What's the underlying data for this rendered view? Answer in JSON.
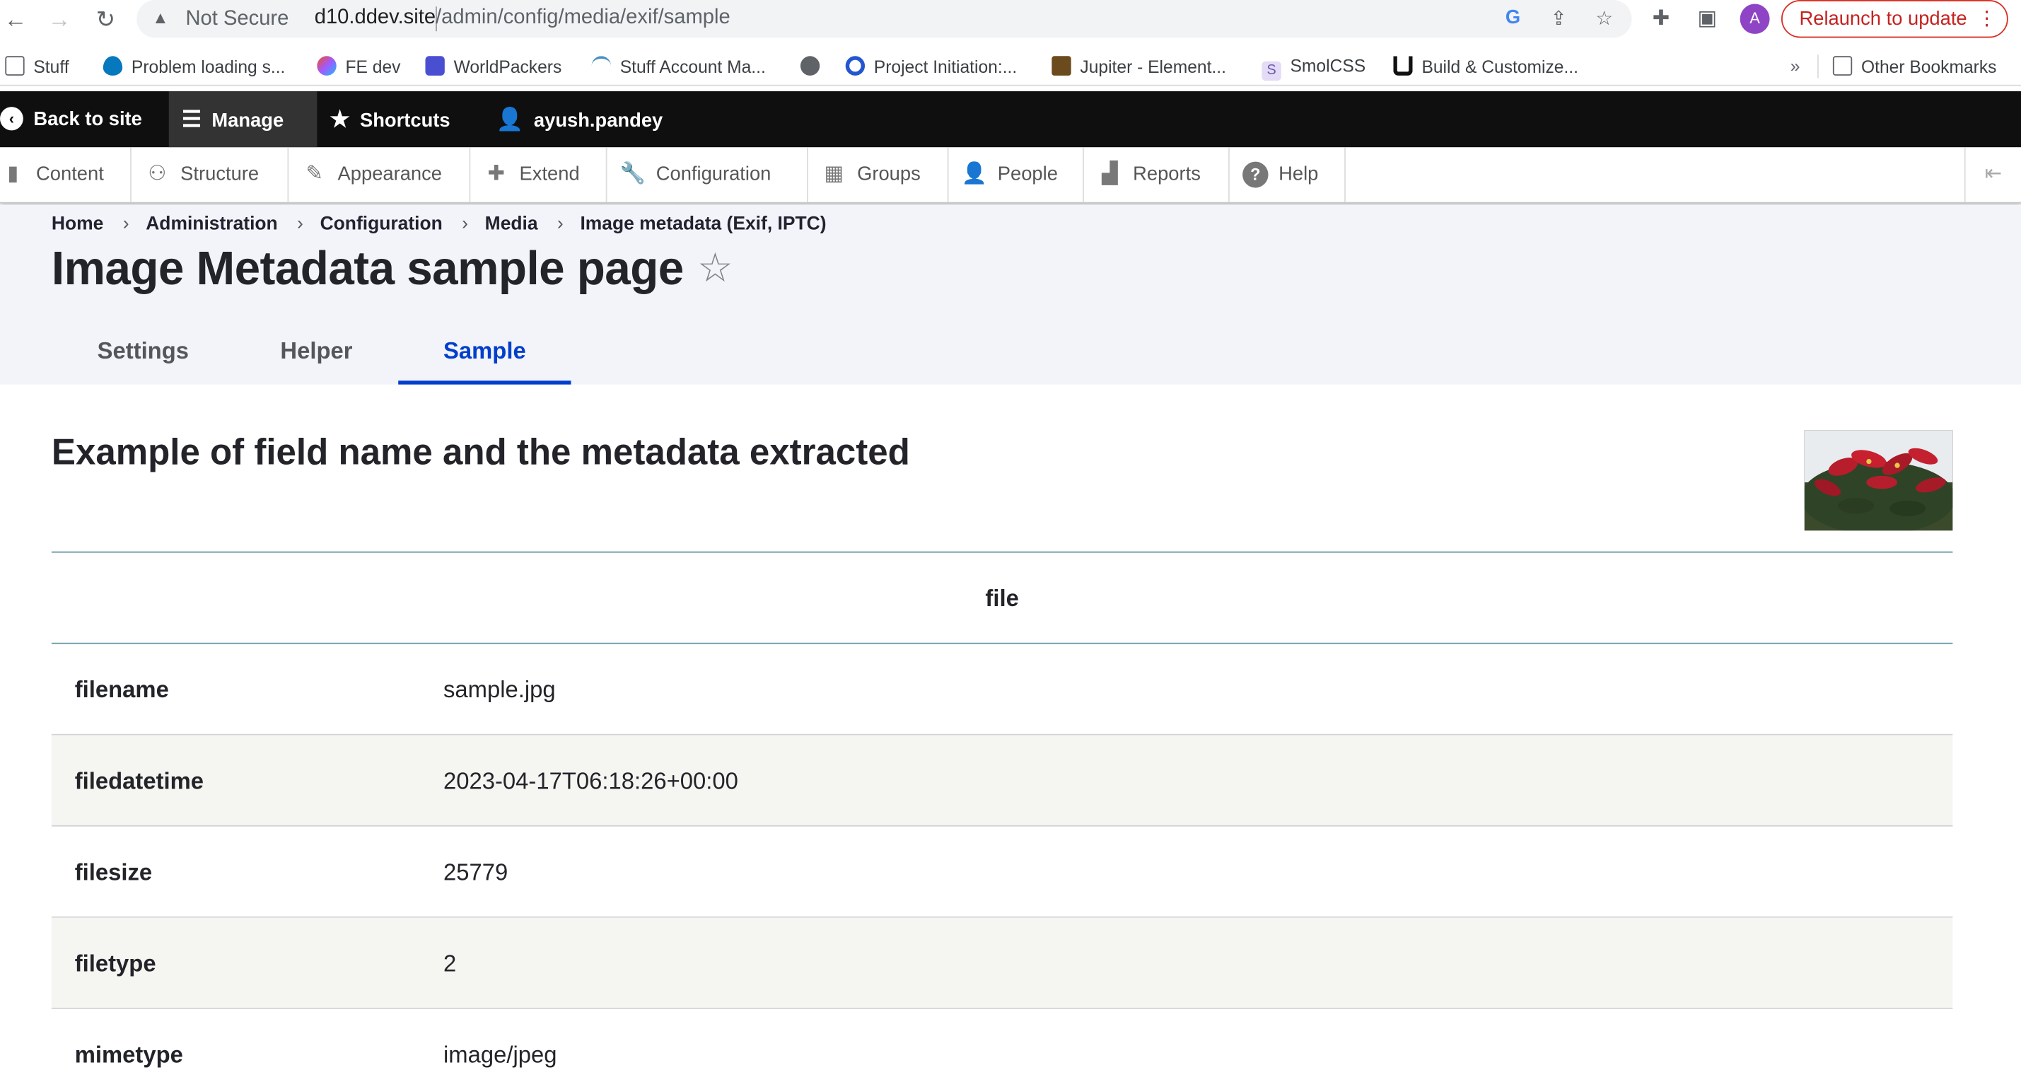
{
  "browser": {
    "security_label": "Not Secure",
    "url_host": "d10.ddev.site",
    "url_path": "/admin/config/media/exif/sample",
    "avatar_letter": "A",
    "relaunch_label": "Relaunch to update"
  },
  "bookmarks": [
    {
      "label": "Stuff",
      "icon": "folder-icon",
      "color": "#5f6368"
    },
    {
      "label": "Problem loading s...",
      "icon": "drupal-icon",
      "color": "#0678be"
    },
    {
      "label": "FE dev",
      "icon": "figma-icon",
      "color": "#f24e1e"
    },
    {
      "label": "WorldPackers",
      "icon": "worldpackers-icon",
      "color": "#4a4fd1"
    },
    {
      "label": "Stuff Account Ma...",
      "icon": "waves-icon",
      "color": "#4a90c2"
    },
    {
      "label": "",
      "icon": "globe-icon",
      "color": "#5f6368"
    },
    {
      "label": "Project Initiation:...",
      "icon": "c-icon",
      "color": "#2456d1"
    },
    {
      "label": "Jupiter - Element...",
      "icon": "jupiter-icon",
      "color": "#6b4a1e"
    },
    {
      "label": "SmolCSS",
      "icon": "s-icon",
      "color": "#b9a8e6"
    },
    {
      "label": "Build & Customize...",
      "icon": "u-icon",
      "color": "#111111"
    }
  ],
  "bookmarks_overflow": "»",
  "other_bookmarks": "Other Bookmarks",
  "toolbar": {
    "back": "Back to site",
    "manage": "Manage",
    "shortcuts": "Shortcuts",
    "user": "ayush.pandey"
  },
  "tray": [
    {
      "label": "Content",
      "icon": "content-icon"
    },
    {
      "label": "Structure",
      "icon": "structure-icon"
    },
    {
      "label": "Appearance",
      "icon": "appearance-icon"
    },
    {
      "label": "Extend",
      "icon": "extend-icon"
    },
    {
      "label": "Configuration",
      "icon": "configuration-icon"
    },
    {
      "label": "Groups",
      "icon": "groups-icon"
    },
    {
      "label": "People",
      "icon": "people-icon"
    },
    {
      "label": "Reports",
      "icon": "reports-icon"
    },
    {
      "label": "Help",
      "icon": "help-icon"
    }
  ],
  "breadcrumb": [
    "Home",
    "Administration",
    "Configuration",
    "Media",
    "Image metadata (Exif, IPTC)"
  ],
  "page_title": "Image Metadata sample page",
  "tabs": [
    {
      "label": "Settings",
      "active": false
    },
    {
      "label": "Helper",
      "active": false
    },
    {
      "label": "Sample",
      "active": true
    }
  ],
  "section_heading": "Example of field name and the metadata extracted",
  "table": {
    "header": "file",
    "rows": [
      {
        "key": "filename",
        "value": "sample.jpg"
      },
      {
        "key": "filedatetime",
        "value": "2023-04-17T06:18:26+00:00"
      },
      {
        "key": "filesize",
        "value": "25779"
      },
      {
        "key": "filetype",
        "value": "2"
      },
      {
        "key": "mimetype",
        "value": "image/jpeg"
      }
    ]
  },
  "colors": {
    "accent": "#003ecc",
    "toolbar_bg": "#0f0f0f",
    "header_bg": "#f3f4f9",
    "relaunch": "#c5221f"
  }
}
